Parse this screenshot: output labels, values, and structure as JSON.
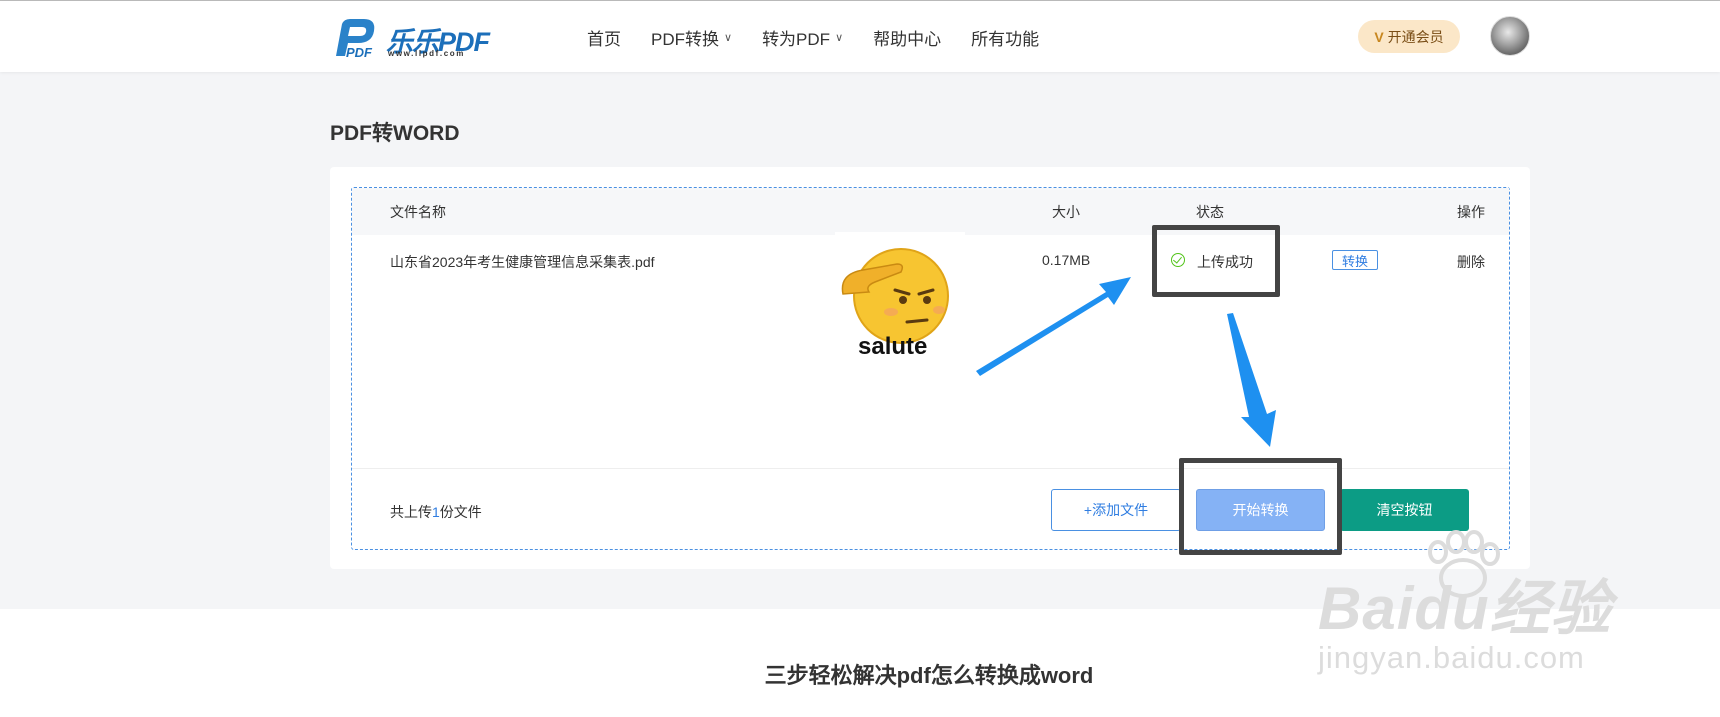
{
  "header": {
    "logo_name": "乐乐PDF",
    "logo_url": "www.llpdf.com",
    "nav": [
      {
        "label": "首页",
        "has_dropdown": false
      },
      {
        "label": "PDF转换",
        "has_dropdown": true
      },
      {
        "label": "转为PDF",
        "has_dropdown": true
      },
      {
        "label": "帮助中心",
        "has_dropdown": false
      },
      {
        "label": "所有功能",
        "has_dropdown": false
      }
    ],
    "vip_label": "开通会员",
    "vip_icon": "V"
  },
  "page": {
    "title": "PDF转WORD"
  },
  "table": {
    "headers": {
      "name": "文件名称",
      "size": "大小",
      "status": "状态",
      "action": "操作"
    },
    "rows": [
      {
        "name": "山东省2023年考生健康管理信息采集表.pdf",
        "size": "0.17MB",
        "status": "上传成功",
        "convert": "转换",
        "delete": "删除"
      }
    ]
  },
  "footer": {
    "count_prefix": "共上传",
    "count": "1",
    "count_suffix": "份文件",
    "add_button": "+添加文件",
    "start_button": "开始转换",
    "clear_button": "清空按钮"
  },
  "sticker": {
    "label": "salute"
  },
  "lower": {
    "title": "三步轻松解决pdf怎么转换成word"
  },
  "watermark": {
    "main": "Baidu经验",
    "sub": "jingyan.baidu.com"
  },
  "colors": {
    "brand": "#1c6fba",
    "link": "#2f7de1",
    "start_button": "#85b2f5",
    "clear_button": "#0c9c85",
    "success": "#52c41a",
    "annotation_arrow": "#1e90f0",
    "annotation_box": "#444444"
  }
}
